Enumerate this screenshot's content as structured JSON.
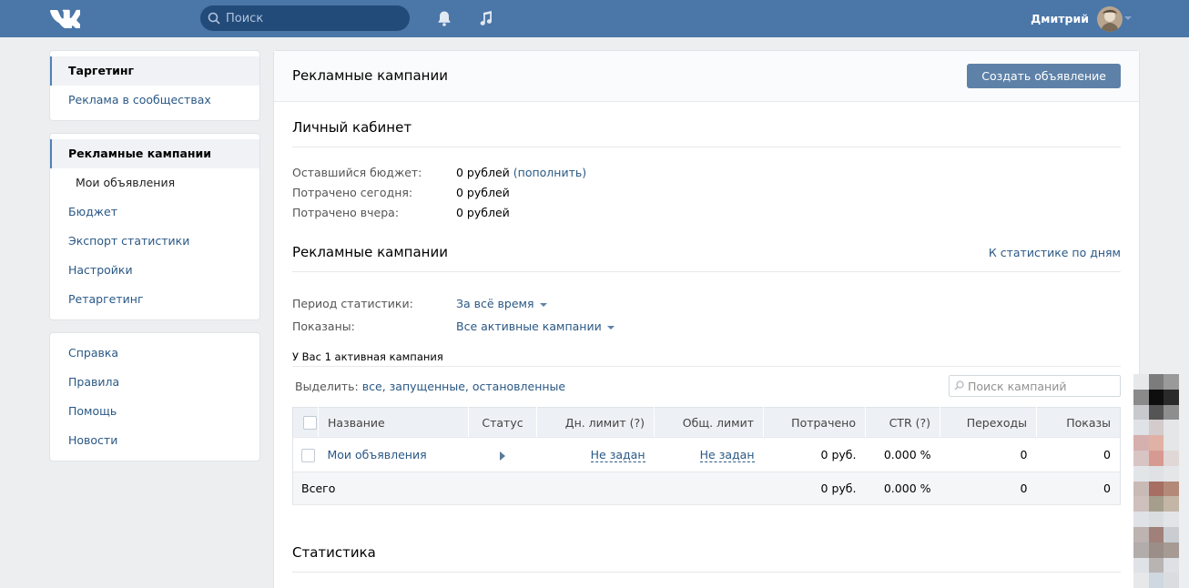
{
  "header": {
    "logo": "vk-logo-icon",
    "search_placeholder": "Поиск",
    "user_name": "Дмитрий",
    "icons": [
      "bell-icon",
      "music-icon"
    ]
  },
  "nav": {
    "block1": [
      {
        "label": "Таргетинг",
        "active": true
      },
      {
        "label": "Реклама в сообществах"
      }
    ],
    "block2": [
      {
        "label": "Рекламные кампании",
        "active": true
      },
      {
        "label": "Мои объявления",
        "sub": true
      },
      {
        "label": "Бюджет"
      },
      {
        "label": "Экспорт статистики"
      },
      {
        "label": "Настройки"
      },
      {
        "label": "Ретаргетинг"
      }
    ],
    "block3": [
      {
        "label": "Справка"
      },
      {
        "label": "Правила"
      },
      {
        "label": "Помощь"
      },
      {
        "label": "Новости"
      }
    ]
  },
  "main": {
    "title": "Рекламные кампании",
    "create_button": "Создать объявление",
    "cabinet": {
      "title": "Личный кабинет",
      "rows": [
        {
          "label": "Оставшийся бюджет:",
          "value": "0 рублей",
          "link": "(пополнить)"
        },
        {
          "label": "Потрачено сегодня:",
          "value": "0 рублей"
        },
        {
          "label": "Потрачено вчера:",
          "value": "0 рублей"
        }
      ]
    },
    "campaigns": {
      "title": "Рекламные кампании",
      "stats_link": "К статистике по дням",
      "period_label": "Период статистики:",
      "period_value": "За всё время",
      "shown_label": "Показаны:",
      "shown_value": "Все активные кампании",
      "active_count": "У Вас 1 активная кампания",
      "select_label": "Выделить:",
      "select_all": "все",
      "select_running": "запущенные",
      "select_stopped": "остановленные",
      "search_placeholder": "Поиск кампаний",
      "columns": [
        "Название",
        "Статус",
        "Дн. лимит (?)",
        "Общ. лимит",
        "Потрачено",
        "CTR (?)",
        "Переходы",
        "Показы"
      ],
      "rows": [
        {
          "name": "Мои объявления",
          "day_limit": "Не задан",
          "total_limit": "Не задан",
          "spent": "0 руб.",
          "ctr": "0.000 %",
          "clicks": "0",
          "views": "0"
        }
      ],
      "total": {
        "label": "Всего",
        "spent": "0 руб.",
        "ctr": "0.000 %",
        "clicks": "0",
        "views": "0"
      }
    },
    "statistics_title": "Статистика"
  },
  "colors": {
    "header_bg": "#4a76a8",
    "link": "#2a5885",
    "button_bg": "#5e81a8",
    "page_bg": "#edeef0"
  }
}
